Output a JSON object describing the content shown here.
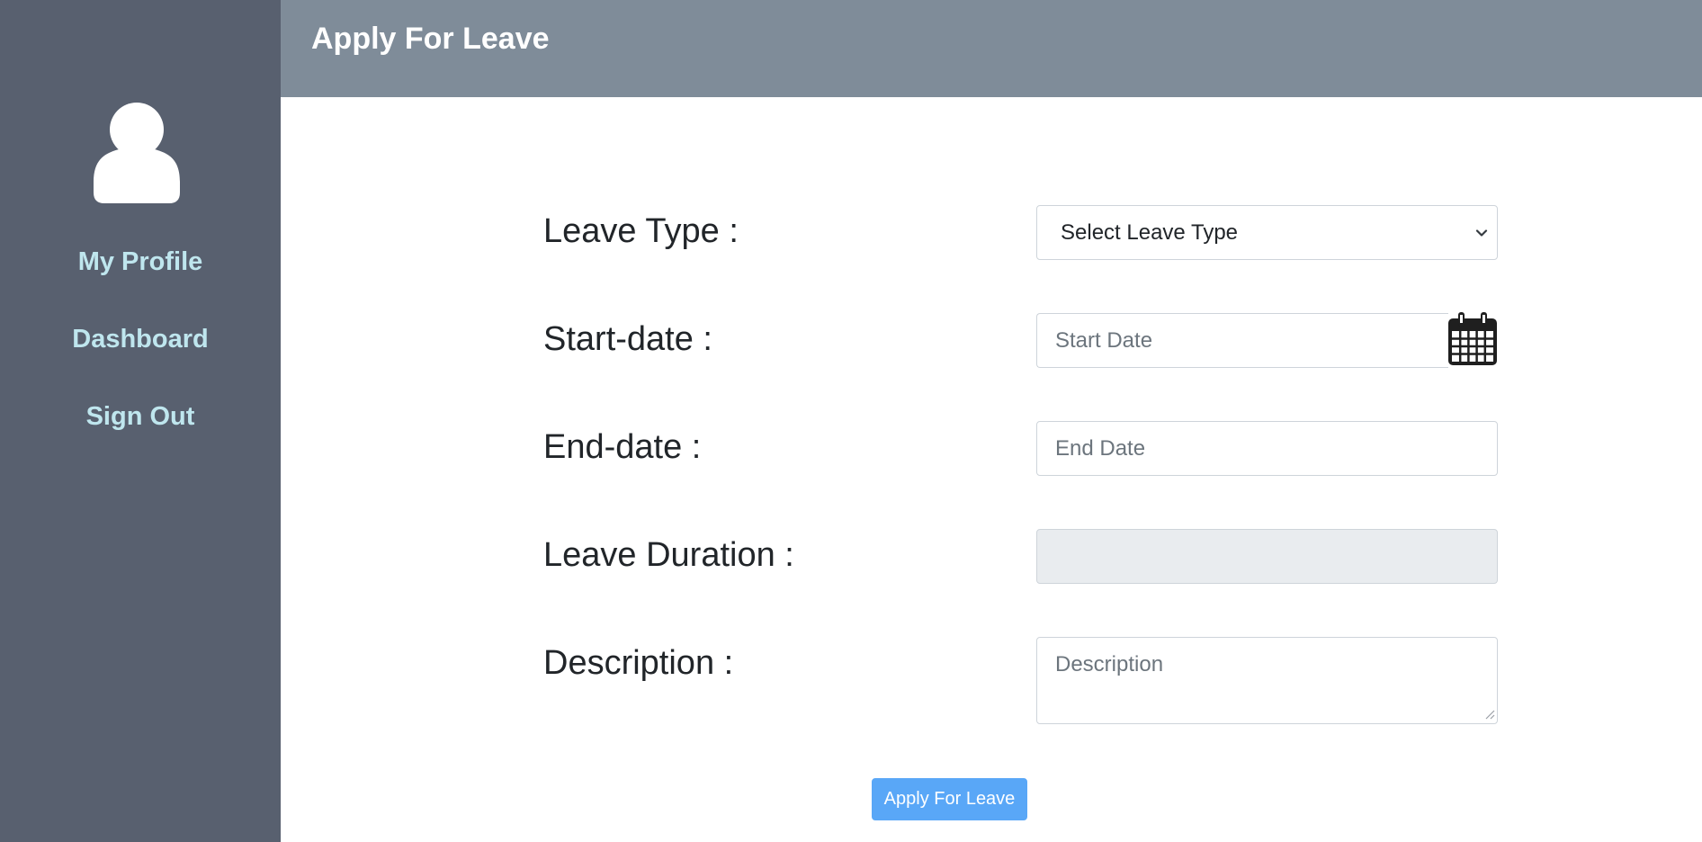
{
  "sidebar": {
    "avatar_icon": "user-icon",
    "items": [
      {
        "label": "My Profile"
      },
      {
        "label": "Dashboard"
      },
      {
        "label": "Sign Out"
      }
    ]
  },
  "header": {
    "title": "Apply For Leave"
  },
  "form": {
    "leave_type": {
      "label": "Leave Type :",
      "selected": "Select Leave Type"
    },
    "start_date": {
      "label": "Start-date :",
      "placeholder": "Start Date",
      "icon": "calendar-icon"
    },
    "end_date": {
      "label": "End-date :",
      "placeholder": "End Date"
    },
    "leave_duration": {
      "label": "Leave Duration :",
      "value": ""
    },
    "description": {
      "label": "Description :",
      "placeholder": "Description"
    },
    "submit_label": "Apply For Leave"
  },
  "colors": {
    "sidebar_bg": "#58606f",
    "header_bg": "#7f8c99",
    "nav_text": "#bfe6ee",
    "button_bg": "#59a7f7",
    "readonly_bg": "#e9ecef"
  }
}
